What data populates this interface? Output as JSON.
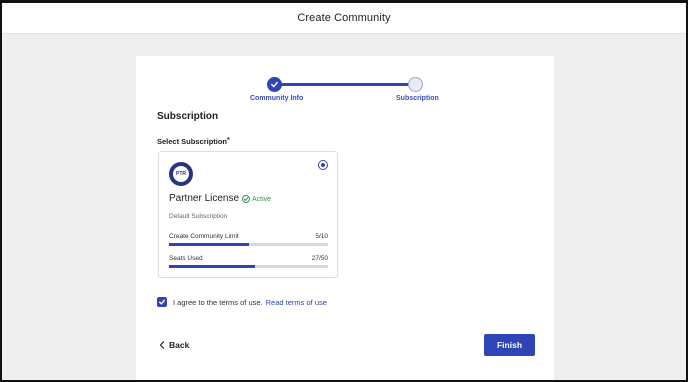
{
  "header": {
    "title": "Create Community"
  },
  "stepper": {
    "steps": [
      {
        "label": "Community Info",
        "status": "completed"
      },
      {
        "label": "Subscription",
        "status": "current"
      }
    ]
  },
  "section": {
    "title": "Subscription",
    "select_label": "Select Subscription",
    "required_mark": "*"
  },
  "subscription_card": {
    "logo_text": "PTR",
    "name": "Partner License",
    "status": "Active",
    "description": "Default Subscription",
    "selected": true,
    "metrics": [
      {
        "label": "Create Community Limit",
        "value_text": "5/10",
        "fraction": 0.5
      },
      {
        "label": "Seats Used",
        "value_text": "27/50",
        "fraction": 0.54
      }
    ]
  },
  "terms": {
    "checked": true,
    "text": "I agree to the terms of use.",
    "link_text": "Read terms of use"
  },
  "actions": {
    "back_label": "Back",
    "finish_label": "Finish"
  },
  "colors": {
    "primary": "#2f45b5",
    "success": "#2e9a4a",
    "page_background": "#efefef"
  },
  "icons": {
    "step_complete": "check-icon",
    "status": "check-circle-icon",
    "back": "chevron-left-icon",
    "checkbox": "check-icon"
  }
}
